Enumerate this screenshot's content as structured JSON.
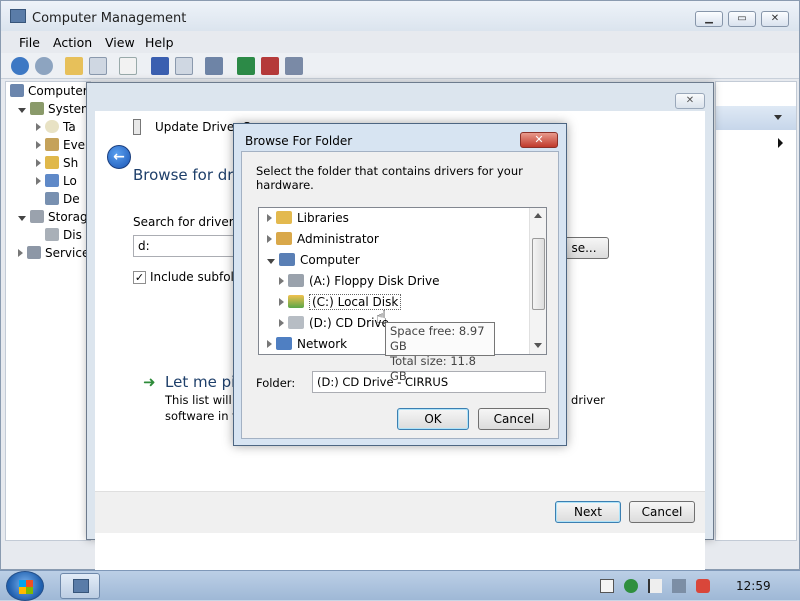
{
  "main_window": {
    "title": "Computer Management",
    "menu": [
      "File",
      "Action",
      "View",
      "Help"
    ],
    "tree": [
      {
        "label": "Computer",
        "level": 0
      },
      {
        "label": "System",
        "level": 1
      },
      {
        "label": "Ta",
        "level": 2
      },
      {
        "label": "Eve",
        "level": 2
      },
      {
        "label": "Sh",
        "level": 2
      },
      {
        "label": "Lo",
        "level": 2
      },
      {
        "label": "De",
        "level": 2
      },
      {
        "label": "Storag",
        "level": 1
      },
      {
        "label": "Dis",
        "level": 2
      },
      {
        "label": "Service",
        "level": 1
      }
    ]
  },
  "wizard": {
    "title": "Update Driver So",
    "heading": "Browse for driv",
    "search_label": "Search for driver so",
    "path_value": "d:",
    "browse_label": "se...",
    "include_subfolders": "Include subfolde",
    "let_me_pick": "Let me pic",
    "let_me_desc_1": "This list will s",
    "let_me_desc_2": "software in th",
    "let_me_desc_right": "ll driver",
    "next_label": "Next",
    "cancel_label": "Cancel"
  },
  "browse_dialog": {
    "title": "Browse For Folder",
    "instruction": "Select the folder that contains drivers for your hardware.",
    "tree": [
      {
        "label": "Libraries",
        "expanded": false,
        "level": 0,
        "icon": "libraries-icon"
      },
      {
        "label": "Administrator",
        "expanded": false,
        "level": 0,
        "icon": "user-folder-icon"
      },
      {
        "label": "Computer",
        "expanded": true,
        "level": 0,
        "icon": "computer-icon"
      },
      {
        "label": "(A:) Floppy Disk Drive",
        "expanded": false,
        "level": 1,
        "icon": "floppy-icon"
      },
      {
        "label": "(C:) Local Disk",
        "expanded": false,
        "level": 1,
        "icon": "local-disk-icon"
      },
      {
        "label": "(D:) CD Drive",
        "expanded": false,
        "level": 1,
        "icon": "cd-drive-icon"
      },
      {
        "label": "Network",
        "expanded": false,
        "level": 0,
        "icon": "network-icon"
      }
    ],
    "tooltip_line1": "Space free: 8.97 GB",
    "tooltip_line2": "Total size: 11.8 GB",
    "folder_label": "Folder:",
    "folder_value": "(D:) CD Drive - CIRRUS",
    "ok_label": "OK",
    "cancel_label": "Cancel",
    "close_label": "✕"
  },
  "taskbar": {
    "clock": "12:59"
  },
  "colors": {
    "accent": "#3c7fb1",
    "link_green": "#2e8b3a",
    "heading_blue": "#1e3f6a"
  }
}
